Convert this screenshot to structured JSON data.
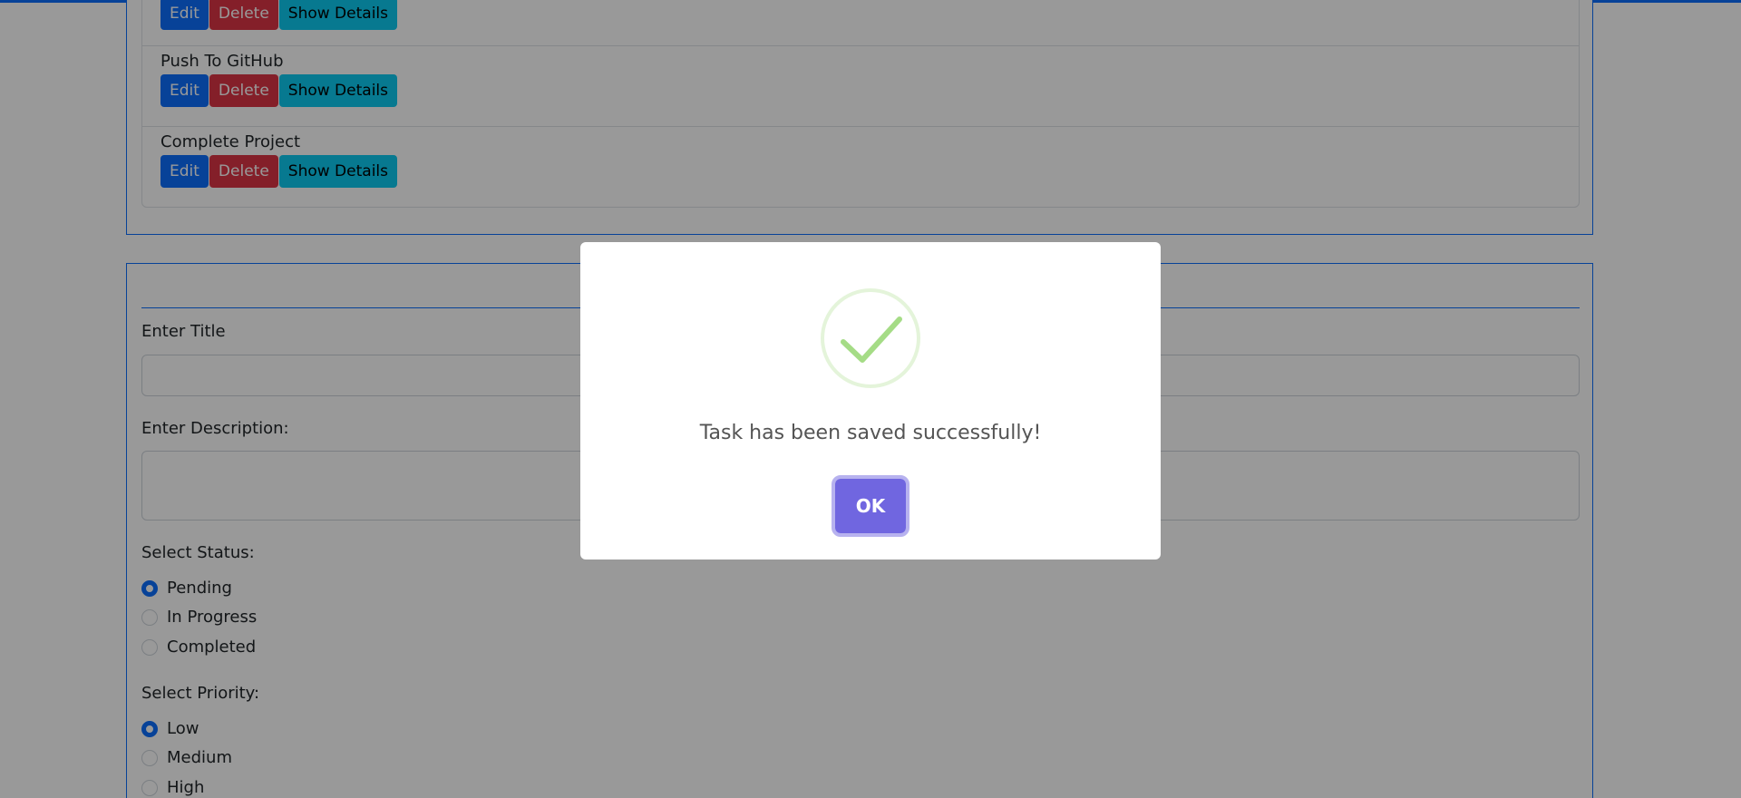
{
  "tasks": [
    {
      "title": "",
      "edit_label": "Edit",
      "delete_label": "Delete",
      "details_label": "Show Details"
    },
    {
      "title": "Push To GitHub",
      "edit_label": "Edit",
      "delete_label": "Delete",
      "details_label": "Show Details"
    },
    {
      "title": "Complete Project",
      "edit_label": "Edit",
      "delete_label": "Delete",
      "details_label": "Show Details"
    }
  ],
  "form": {
    "title_label": "Enter Title",
    "title_value": "",
    "description_label": "Enter Description:",
    "description_value": "",
    "status_label": "Select Status:",
    "status_options": [
      "Pending",
      "In Progress",
      "Completed"
    ],
    "status_selected": "Pending",
    "priority_label": "Select Priority:",
    "priority_options": [
      "Low",
      "Medium",
      "High"
    ],
    "priority_selected": "Low"
  },
  "modal": {
    "message": "Task has been saved successfully!",
    "ok_label": "OK",
    "icon": "success-check-icon"
  },
  "colors": {
    "primary": "#0d6efd",
    "danger": "#dc3545",
    "info": "#0dcaf0",
    "confirm": "#7066e0",
    "success_icon": "#a5dc86"
  }
}
